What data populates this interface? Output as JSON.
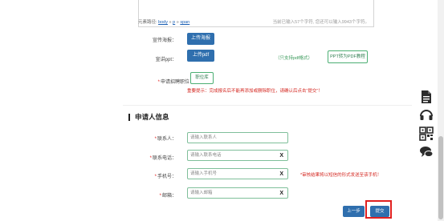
{
  "editor": {
    "path_label": "元素路径:",
    "path_items": [
      "body",
      "p",
      "span"
    ],
    "path_sep": "»",
    "count_text": "当前已输入57个字符, 您还可以输入9943个字符。"
  },
  "form_top": {
    "poster_label": "宣传海报：",
    "poster_button": "上传海报",
    "ppt_label": "宣讲ppt：",
    "ppt_button": "上传pdf",
    "ppt_note": "（只支持pdf格式）",
    "ppt_convert_button": "PPT转为PDF教程",
    "position_label": "申请招聘职位：",
    "position_button": "职位库",
    "warning": "重要提示：完成报名后不能再添加或删除职位，请确认后点击“提交”！"
  },
  "applicant": {
    "section_title": "申请人信息",
    "contact_label": "联系人：",
    "contact_placeholder": "请输入联系人",
    "phone_label": "联系电话：",
    "phone_placeholder": "请输入联系电话",
    "mobile_label": "手机号：",
    "mobile_placeholder": "请输入手机号",
    "mobile_note": "*审核结果将以短信的形式发送至该手机！",
    "email_label": "邮箱：",
    "email_placeholder": "请输入邮箱",
    "clear": "X"
  },
  "actions": {
    "prev": "上一步",
    "submit": "提交"
  },
  "sidebar_icons": [
    "document-icon",
    "headset-icon",
    "qrcode-icon",
    "chat-icon"
  ]
}
